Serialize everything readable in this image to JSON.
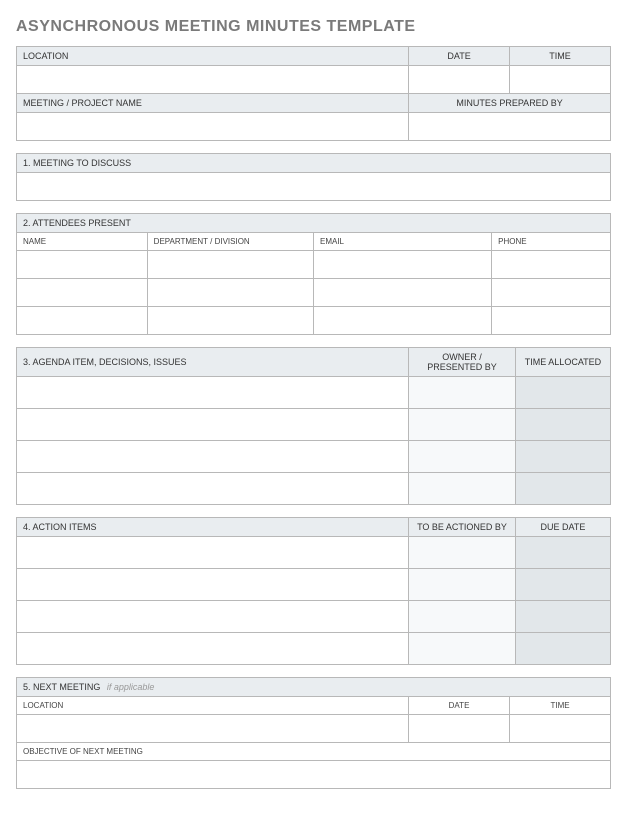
{
  "title": "ASYNCHRONOUS MEETING MINUTES TEMPLATE",
  "header": {
    "location": "LOCATION",
    "date": "DATE",
    "time": "TIME",
    "meetingProjectName": "MEETING / PROJECT NAME",
    "minutesPreparedBy": "MINUTES PREPARED BY"
  },
  "section1": {
    "title": "1. MEETING TO DISCUSS"
  },
  "section2": {
    "title": "2. ATTENDEES PRESENT",
    "cols": {
      "name": "NAME",
      "department": "DEPARTMENT / DIVISION",
      "email": "EMAIL",
      "phone": "PHONE"
    }
  },
  "section3": {
    "title": "3. AGENDA ITEM, DECISIONS, ISSUES",
    "cols": {
      "owner": "OWNER / PRESENTED BY",
      "timeAllocated": "TIME ALLOCATED"
    }
  },
  "section4": {
    "title": "4. ACTION ITEMS",
    "cols": {
      "actionedBy": "TO BE ACTIONED BY",
      "dueDate": "DUE DATE"
    }
  },
  "section5": {
    "title": "5. NEXT MEETING",
    "note": "if applicable",
    "location": "LOCATION",
    "date": "DATE",
    "time": "TIME",
    "objective": "OBJECTIVE OF NEXT MEETING"
  }
}
